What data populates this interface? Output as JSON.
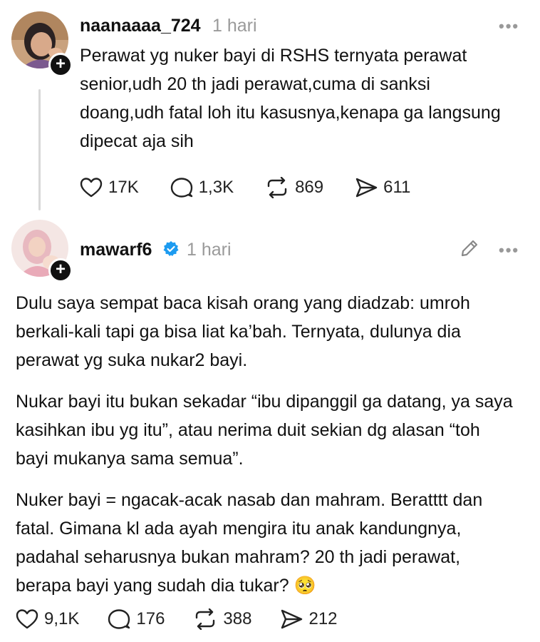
{
  "post1": {
    "username": "naanaaaa_724",
    "time": "1 hari",
    "more": "•••",
    "text": "Perawat yg nuker bayi di RSHS ternyata perawat senior,udh 20 th jadi perawat,cuma di sanksi doang,udh fatal loh itu kasusnya,kenapa ga langsung dipecat aja sih",
    "likes": "17K",
    "replies": "1,3K",
    "reposts": "869",
    "shares": "611"
  },
  "post2": {
    "username": "mawarf6",
    "time": "1 hari",
    "more": "•••",
    "paragraphs": [
      "Dulu saya sempat baca kisah orang yang diadzab: umroh berkali-kali tapi ga bisa liat ka’bah. Ternyata, dulunya dia perawat yg suka nukar2 bayi.",
      "Nukar bayi itu bukan sekadar “ibu dipanggil ga datang, ya saya kasihkan ibu yg itu”, atau nerima duit sekian dg alasan “toh bayi mukanya sama semua”.",
      "Nuker bayi = ngacak-acak nasab dan mahram. Beratttt dan fatal. Gimana kl ada ayah mengira itu anak kandungnya, padahal seharusnya bukan mahram? 20 th jadi perawat, berapa bayi yang sudah dia tukar? 🥺"
    ],
    "likes": "9,1K",
    "replies": "176",
    "reposts": "388",
    "shares": "212"
  },
  "colors": {
    "verified": "#1d9bf0",
    "muted": "#9a9a9a"
  },
  "icons": [
    "heart-icon",
    "comment-icon",
    "repost-icon",
    "share-icon",
    "plus-icon",
    "verified-icon",
    "edit-icon",
    "more-icon"
  ]
}
